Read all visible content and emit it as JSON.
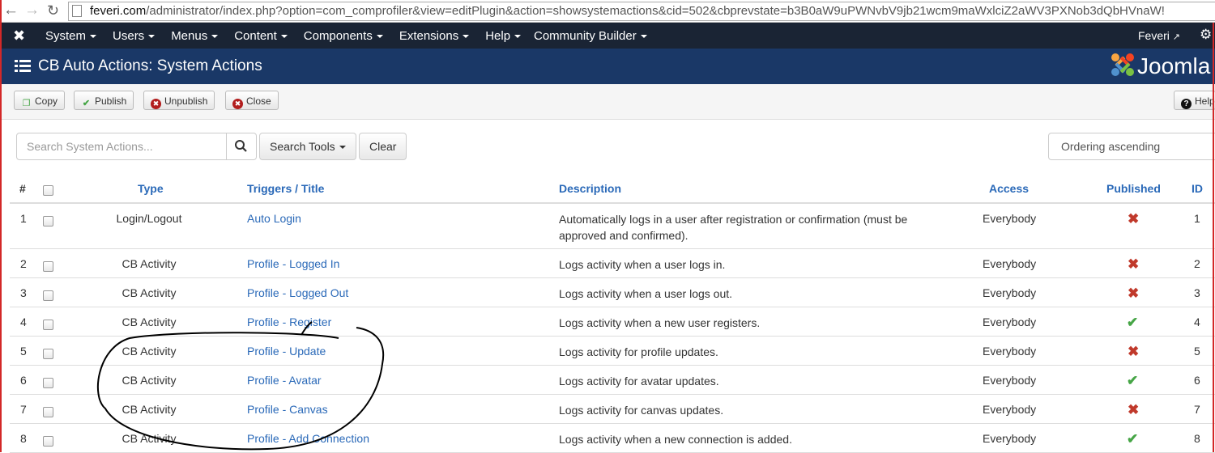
{
  "browser": {
    "url_prefix": "feveri.com",
    "url_rest": "/administrator/index.php?option=com_comprofiler&view=editPlugin&action=showsystemactions&cid=502&cbprevstate=b3B0aW9uPWNvbV9jb21wcm9maWxlciZ2aWV3PXNob3dQbHVnaW!"
  },
  "topnav": {
    "menus": [
      "System",
      "Users",
      "Menus",
      "Content",
      "Components",
      "Extensions",
      "Help"
    ],
    "community_builder": "Community Builder",
    "user": "Feveri"
  },
  "titlebar": {
    "title": "CB Auto Actions: System Actions",
    "brand": "Joomla"
  },
  "toolbar": {
    "copy": "Copy",
    "publish": "Publish",
    "unpublish": "Unpublish",
    "close": "Close",
    "help": "Help"
  },
  "filters": {
    "search_placeholder": "Search System Actions...",
    "search_tools": "Search Tools",
    "clear": "Clear",
    "ordering": "Ordering ascending"
  },
  "table": {
    "headers": {
      "num": "#",
      "type": "Type",
      "trigger": "Triggers / Title",
      "description": "Description",
      "access": "Access",
      "published": "Published",
      "id": "ID"
    },
    "rows": [
      {
        "num": "1",
        "type": "Login/Logout",
        "title": "Auto Login",
        "description": "Automatically logs in a user after registration or confirmation (must be approved and confirmed).",
        "access": "Everybody",
        "published": false,
        "id": "1"
      },
      {
        "num": "2",
        "type": "CB Activity",
        "title": "Profile - Logged In",
        "description": "Logs activity when a user logs in.",
        "access": "Everybody",
        "published": false,
        "id": "2"
      },
      {
        "num": "3",
        "type": "CB Activity",
        "title": "Profile - Logged Out",
        "description": "Logs activity when a user logs out.",
        "access": "Everybody",
        "published": false,
        "id": "3"
      },
      {
        "num": "4",
        "type": "CB Activity",
        "title": "Profile - Register",
        "description": "Logs activity when a new user registers.",
        "access": "Everybody",
        "published": true,
        "id": "4"
      },
      {
        "num": "5",
        "type": "CB Activity",
        "title": "Profile - Update",
        "description": "Logs activity for profile updates.",
        "access": "Everybody",
        "published": false,
        "id": "5"
      },
      {
        "num": "6",
        "type": "CB Activity",
        "title": "Profile - Avatar",
        "description": "Logs activity for avatar updates.",
        "access": "Everybody",
        "published": true,
        "id": "6"
      },
      {
        "num": "7",
        "type": "CB Activity",
        "title": "Profile - Canvas",
        "description": "Logs activity for canvas updates.",
        "access": "Everybody",
        "published": false,
        "id": "7"
      },
      {
        "num": "8",
        "type": "CB Activity",
        "title": "Profile - Add Connection",
        "description": "Logs activity when a new connection is added.",
        "access": "Everybody",
        "published": true,
        "id": "8"
      }
    ]
  },
  "colors": {
    "nav_bg": "#1a2434",
    "title_bg": "#1a3867",
    "link": "#2a69b8",
    "unpublished": "#c0392b",
    "published": "#46a546"
  },
  "icons": {
    "published_true": "check-icon",
    "published_false": "x-icon"
  }
}
